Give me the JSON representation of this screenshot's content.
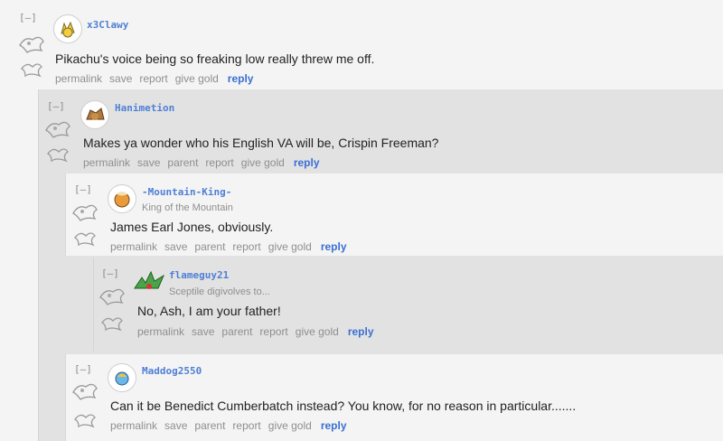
{
  "comments": [
    {
      "author": "x3Clawy",
      "flair": "",
      "text": "Pikachu's voice being so freaking low really threw me off.",
      "actions": [
        "permalink",
        "save",
        "report",
        "give gold"
      ],
      "reply": "reply",
      "toggle": "[–]"
    },
    {
      "author": "Hanimetion",
      "flair": "",
      "text": "Makes ya wonder who his English VA will be, Crispin Freeman?",
      "actions": [
        "permalink",
        "save",
        "parent",
        "report",
        "give gold"
      ],
      "reply": "reply",
      "toggle": "[–]"
    },
    {
      "author": "-Mountain-King-",
      "flair": "King of the Mountain",
      "text": "James Earl Jones, obviously.",
      "actions": [
        "permalink",
        "save",
        "parent",
        "report",
        "give gold"
      ],
      "reply": "reply",
      "toggle": "[–]"
    },
    {
      "author": "flameguy21",
      "flair": "Sceptile digivolves to...",
      "text": "No, Ash, I am your father!",
      "actions": [
        "permalink",
        "save",
        "parent",
        "report",
        "give gold"
      ],
      "reply": "reply",
      "toggle": "[–]"
    },
    {
      "author": "Maddog2550",
      "flair": "",
      "text": "Can it be Benedict Cumberbatch instead? You know, for no reason in particular.......",
      "actions": [
        "permalink",
        "save",
        "parent",
        "report",
        "give gold"
      ],
      "reply": "reply",
      "toggle": "[–]"
    }
  ],
  "colors": {
    "author": "#4f7fd6",
    "reply": "#3b6fd4",
    "muted": "#8f8f8f",
    "text": "#222222",
    "panel": "#e2e2e2",
    "page": "#f4f4f4"
  },
  "icons": {
    "avatar": "pokemon-sprite-avatar",
    "decoration": "legendary-pokemon-outline-icon"
  }
}
